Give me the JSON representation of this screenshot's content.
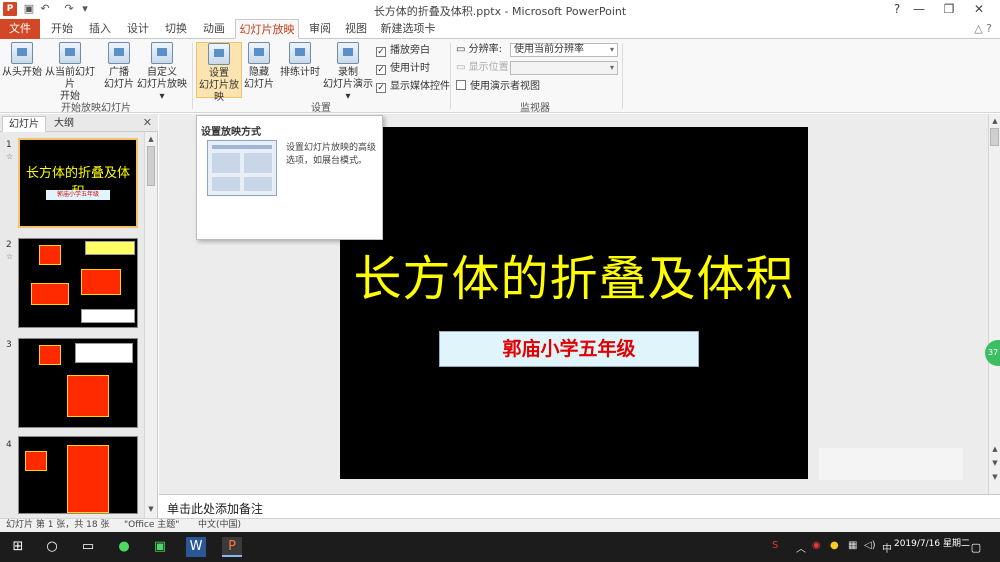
{
  "window": {
    "app_badge": "P",
    "title": "长方体的折叠及体积.pptx - Microsoft PowerPoint"
  },
  "tabs": [
    {
      "label": "文件"
    },
    {
      "label": "开始"
    },
    {
      "label": "插入"
    },
    {
      "label": "设计"
    },
    {
      "label": "切换"
    },
    {
      "label": "动画"
    },
    {
      "label": "幻灯片放映"
    },
    {
      "label": "审阅"
    },
    {
      "label": "视图"
    },
    {
      "label": "新建选项卡"
    }
  ],
  "ribbon": {
    "buttons": [
      {
        "line1": "从头开始",
        "line2": ""
      },
      {
        "line1": "从当前幻灯片",
        "line2": "开始"
      },
      {
        "line1": "广播",
        "line2": "幻灯片"
      },
      {
        "line1": "自定义",
        "line2": "幻灯片放映 ▾"
      },
      {
        "line1": "设置",
        "line2": "幻灯片放映"
      },
      {
        "line1": "隐藏",
        "line2": "幻灯片"
      },
      {
        "line1": "排练计时",
        "line2": ""
      },
      {
        "line1": "录制",
        "line2": "幻灯片演示 ▾"
      }
    ],
    "checkboxes": [
      {
        "label": "播放旁白",
        "mark": "✓"
      },
      {
        "label": "使用计时",
        "mark": "✓"
      },
      {
        "label": "显示媒体控件",
        "mark": "✓"
      }
    ],
    "monitor": {
      "resolution_label": "分辨率:",
      "resolution_value": "使用当前分辨率",
      "show_on_label": "显示位置:",
      "presenter_view": "使用演示者视图"
    },
    "groups": [
      "开始放映幻灯片",
      "设置",
      "监视器"
    ]
  },
  "left_pane": {
    "tabs": [
      "幻灯片",
      "大纲"
    ],
    "slides": [
      {
        "num": "1",
        "title": "长方体的折叠及体积",
        "subtitle": "郭庙小学五年级"
      },
      {
        "num": "2"
      },
      {
        "num": "3"
      },
      {
        "num": "4"
      }
    ]
  },
  "slide": {
    "title": "长方体的折叠及体积",
    "subtitle": "郭庙小学五年级"
  },
  "tooltip": {
    "title": "设置放映方式",
    "description": "设置幻灯片放映的高级选项，如展台模式。"
  },
  "notes_placeholder": "单击此处添加备注",
  "status": {
    "slide_info": "幻灯片 第 1 张，共 18 张",
    "theme": "\"Office 主题\"",
    "language": "中文(中国)"
  },
  "taskbar": {
    "time": "",
    "date": "2019/7/16 星期二"
  },
  "badge": "37"
}
